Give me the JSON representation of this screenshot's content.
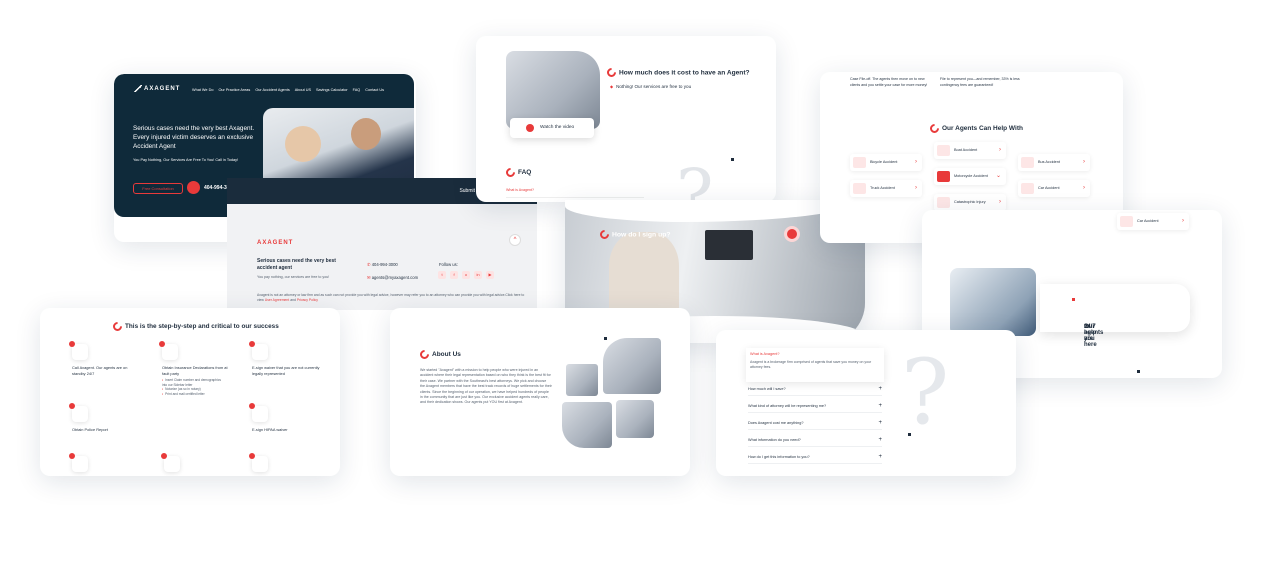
{
  "hero": {
    "logo": "AXAGENT",
    "nav": [
      "What We Do",
      "Our Practice Areas",
      "Our Accident Agents",
      "About US",
      "Savings Calculator",
      "FAQ",
      "Contact Us"
    ],
    "headline": "Serious cases need the very best Axagent. Every injured victim deserves an exclusive Accident Agent",
    "sub": "You Pay Nothing, Our Services Are Free To You! Call in Today!",
    "consult_label": "Free Consultation",
    "phone": "404-994-3000"
  },
  "footer": {
    "submit": "Submit",
    "logo": "AXAGENT",
    "headline": "Serious cases need the very best accident agent",
    "sub": "You pay nothing, our services are free to you!",
    "phone": "404-994-3000",
    "email": "agents@myaxagent.com",
    "follow": "Follow us:",
    "disclaimer_pre": "Axagent is not an attorney or law firm and as such can not provide you with legal advice, however may refer you to an attorney who can provide you with legal advice.Click here to view",
    "user_agreement": "User Agreement",
    "and": "and",
    "privacy": "Privacy Policy"
  },
  "cost": {
    "question": "How much does it cost to have an Agent?",
    "answer": "Nothing! Our services are free to you",
    "watch": "Watch the video",
    "faq_title": "FAQ",
    "faq_item": "What is Axagent?"
  },
  "signup": {
    "title": "How do I sign up?"
  },
  "agents": {
    "p1": "Case File-off. The agents then move on to new clients and you settle your case for more money!",
    "p2": "File to represent you—and remember, 33% is less contingency fees are guaranteed!",
    "title": "Our Agents Can Help With",
    "items": [
      "Bicycle Accident",
      "Boat Accident",
      "Bus Accident",
      "Truck Accident",
      "Motorcycle Accident",
      "Car Accident",
      "Catastrophic Injury"
    ]
  },
  "here": {
    "car": "Car Accident",
    "text_pre": "Our agents are here ",
    "text_hl": "24/7",
    "text_post": " to help you"
  },
  "steps": {
    "title": "This is the step-by-step and critical to our success",
    "s1": "Call Axagent. Our agents are on standby 24/7",
    "s2": "Obtain Insurance Declarations from at fault party",
    "s2_items": [
      "Insert Claim number and demographics into our Sidebar letter",
      "Notarize (as so in notary)",
      "Print and mail certified letter"
    ],
    "s3": "E-sign waiver that you are not currently legally represented",
    "s4": "Obtain Police Report",
    "s5": "E-sign HIPAA waiver"
  },
  "about": {
    "title": "About Us",
    "body": "We started \"Axagent\" with a mission to help people who were injured in an accident where their legal representation based on who they think is the best fit for their case. We partner with the Southeast's best attorneys. We pick and choose the Axagent members that have the best track records of huge settlements for their clients. Since the beginning of our operation, we have helped hundreds of people in the community that are just like you. Our exclusive accident agents really care, and their dedication shows. Our agents put YOU first at Axagent."
  },
  "faq": {
    "open_q": "What is Axagent?",
    "open_a": "Axagent is a brokerage firm comprised of agents that save you money on your attorney fees.",
    "items": [
      "How much will I save?",
      "What kind of attorney will be representing me?",
      "Does Axagent cost me anything?",
      "What information do you need?",
      "How do I get this information to you?"
    ]
  }
}
